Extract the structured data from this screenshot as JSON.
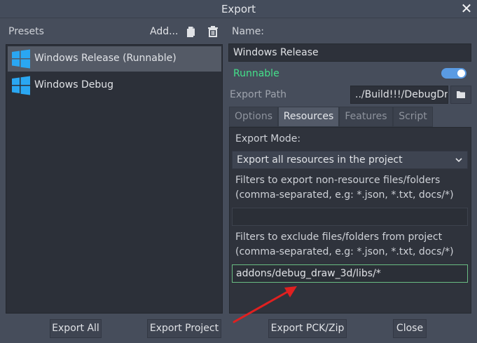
{
  "window": {
    "title": "Export"
  },
  "presets": {
    "label": "Presets",
    "add_label": "Add...",
    "items": [
      {
        "label": "Windows Release (Runnable)",
        "selected": true
      },
      {
        "label": "Windows Debug",
        "selected": false
      }
    ]
  },
  "details": {
    "name_label": "Name:",
    "name_value": "Windows Release",
    "runnable_label": "Runnable",
    "runnable_on": true,
    "export_path_label": "Export Path",
    "export_path_value": "../Build!!!/DebugDra",
    "tabs": [
      "Options",
      "Resources",
      "Features",
      "Script"
    ],
    "active_tab": "Resources",
    "export_mode_label": "Export Mode:",
    "export_mode_value": "Export all resources in the project",
    "filter_include_label_1": "Filters to export non-resource files/folders",
    "filter_include_label_2": "(comma-separated, e.g: *.json, *.txt, docs/*)",
    "filter_include_value": "",
    "filter_exclude_label_1": "Filters to exclude files/folders from project",
    "filter_exclude_label_2": "(comma-separated, e.g: *.json, *.txt, docs/*)",
    "filter_exclude_value": "addons/debug_draw_3d/libs/*"
  },
  "buttons": {
    "export_all": "Export All",
    "export_project": "Export Project",
    "export_pck_zip": "Export PCK/Zip",
    "close": "Close"
  },
  "colors": {
    "runnable_accent": "#44e08a",
    "toggle_on": "#5a9be3",
    "focus_border": "#6abc83",
    "windows_logo": "#2aa7f2",
    "annotation_arrow": "#e02020"
  }
}
